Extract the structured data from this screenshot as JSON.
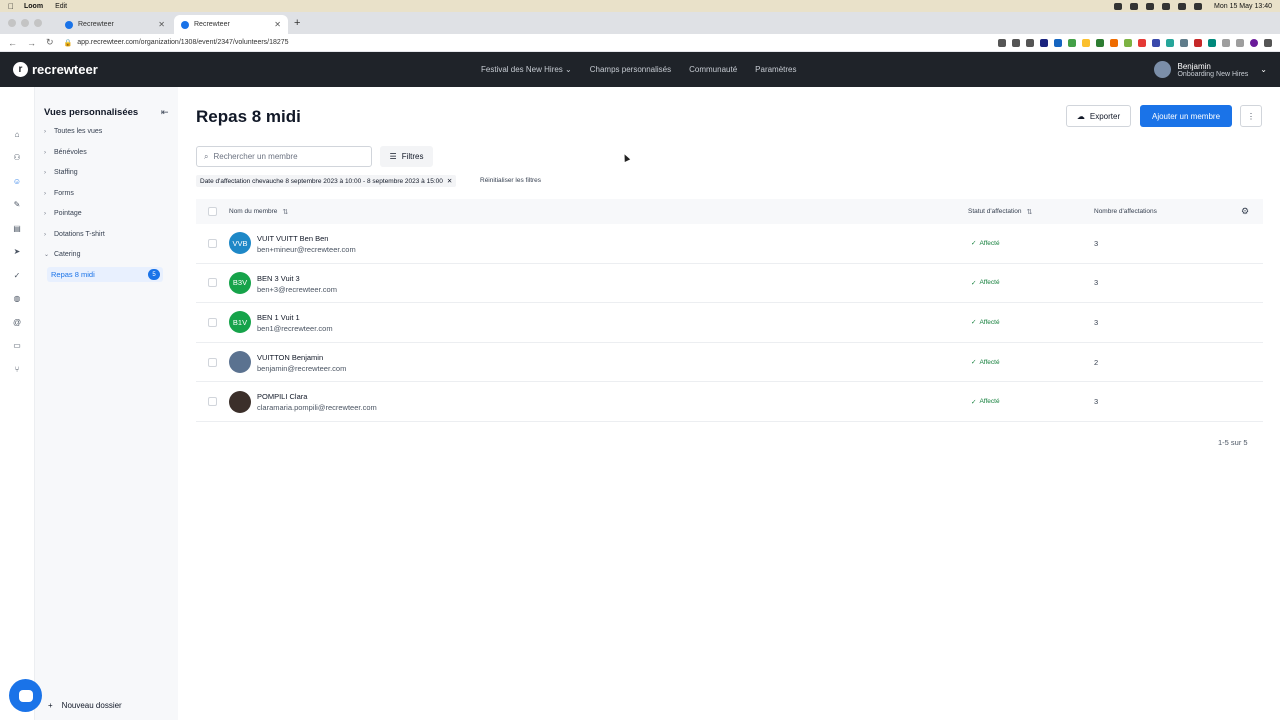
{
  "macbar": {
    "app": "Loom",
    "menu": "Edit",
    "clock": "Mon 15 May  13:40"
  },
  "browser": {
    "tabs": [
      {
        "label": "Recrewteer"
      },
      {
        "label": "Recrewteer"
      }
    ],
    "url": "app.recrewteer.com/organization/1308/event/2347/volunteers/18275"
  },
  "header": {
    "logo": "recrewteer",
    "nav": [
      "Festival des New Hires",
      "Champs personnalisés",
      "Communauté",
      "Paramètres"
    ],
    "user_name": "Benjamin",
    "user_org": "Onboarding New Hires"
  },
  "sidebar": {
    "title": "Vues personnalisées",
    "items": [
      {
        "label": "Toutes les vues"
      },
      {
        "label": "Bénévoles"
      },
      {
        "label": "Staffing"
      },
      {
        "label": "Forms"
      },
      {
        "label": "Pointage"
      },
      {
        "label": "Dotations T-shirt"
      },
      {
        "label": "Catering"
      }
    ],
    "active_sub": {
      "label": "Repas 8 midi",
      "count": "5"
    },
    "new_folder": "Nouveau dossier"
  },
  "main": {
    "title": "Repas 8 midi",
    "export_label": "Exporter",
    "add_label": "Ajouter un membre",
    "search_placeholder": "Rechercher un membre",
    "filters_label": "Filtres",
    "filter_chip": "Date d'affectation chevauche 8 septembre 2023 à 10:00 - 8 septembre 2023 à 15:00",
    "reset_filters": "Réinitialiser les filtres",
    "columns": {
      "name": "Nom du membre",
      "status": "Statut d'affectation",
      "count": "Nombre d'affectations"
    },
    "rows": [
      {
        "initials": "VVB",
        "name": "VUIT VUITT Ben Ben",
        "email": "ben+mineur@recrewteer.com",
        "status": "Affecté",
        "count": "3"
      },
      {
        "initials": "B3V",
        "name": "BEN 3 Vuit 3",
        "email": "ben+3@recrewteer.com",
        "status": "Affecté",
        "count": "3"
      },
      {
        "initials": "B1V",
        "name": "BEN 1 Vuit 1",
        "email": "ben1@recrewteer.com",
        "status": "Affecté",
        "count": "3"
      },
      {
        "initials": "",
        "name": "VUITTON Benjamin",
        "email": "benjamin@recrewteer.com",
        "status": "Affecté",
        "count": "2"
      },
      {
        "initials": "",
        "name": "POMPILI Clara",
        "email": "claramaria.pompili@recrewteer.com",
        "status": "Affecté",
        "count": "3"
      }
    ],
    "pagination": "1-5 sur 5"
  },
  "colors": {
    "accent": "#1a73e8",
    "header_bg": "#1f2329",
    "success": "#15803d",
    "avatar_blue": "#1e88c7",
    "avatar_green": "#16a34a"
  }
}
